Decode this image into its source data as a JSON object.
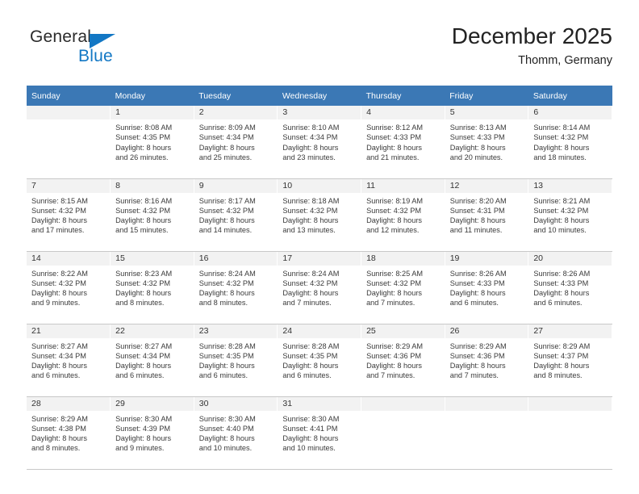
{
  "brand": {
    "name_part1": "General",
    "name_part2": "Blue",
    "accent_color": "#1277c4"
  },
  "header": {
    "title": "December 2025",
    "subtitle": "Thomm, Germany"
  },
  "theme": {
    "header_row_color": "#3b78b5",
    "daynum_band_color": "#f2f2f2",
    "grid_line_color": "#c8c8c8"
  },
  "weekdays": [
    "Sunday",
    "Monday",
    "Tuesday",
    "Wednesday",
    "Thursday",
    "Friday",
    "Saturday"
  ],
  "weeks": [
    [
      {
        "day": "",
        "empty": true,
        "sunrise": "",
        "sunset": "",
        "daylight_line1": "",
        "daylight_line2": ""
      },
      {
        "day": "1",
        "empty": false,
        "sunrise": "Sunrise: 8:08 AM",
        "sunset": "Sunset: 4:35 PM",
        "daylight_line1": "Daylight: 8 hours",
        "daylight_line2": "and 26 minutes."
      },
      {
        "day": "2",
        "empty": false,
        "sunrise": "Sunrise: 8:09 AM",
        "sunset": "Sunset: 4:34 PM",
        "daylight_line1": "Daylight: 8 hours",
        "daylight_line2": "and 25 minutes."
      },
      {
        "day": "3",
        "empty": false,
        "sunrise": "Sunrise: 8:10 AM",
        "sunset": "Sunset: 4:34 PM",
        "daylight_line1": "Daylight: 8 hours",
        "daylight_line2": "and 23 minutes."
      },
      {
        "day": "4",
        "empty": false,
        "sunrise": "Sunrise: 8:12 AM",
        "sunset": "Sunset: 4:33 PM",
        "daylight_line1": "Daylight: 8 hours",
        "daylight_line2": "and 21 minutes."
      },
      {
        "day": "5",
        "empty": false,
        "sunrise": "Sunrise: 8:13 AM",
        "sunset": "Sunset: 4:33 PM",
        "daylight_line1": "Daylight: 8 hours",
        "daylight_line2": "and 20 minutes."
      },
      {
        "day": "6",
        "empty": false,
        "sunrise": "Sunrise: 8:14 AM",
        "sunset": "Sunset: 4:32 PM",
        "daylight_line1": "Daylight: 8 hours",
        "daylight_line2": "and 18 minutes."
      }
    ],
    [
      {
        "day": "7",
        "empty": false,
        "sunrise": "Sunrise: 8:15 AM",
        "sunset": "Sunset: 4:32 PM",
        "daylight_line1": "Daylight: 8 hours",
        "daylight_line2": "and 17 minutes."
      },
      {
        "day": "8",
        "empty": false,
        "sunrise": "Sunrise: 8:16 AM",
        "sunset": "Sunset: 4:32 PM",
        "daylight_line1": "Daylight: 8 hours",
        "daylight_line2": "and 15 minutes."
      },
      {
        "day": "9",
        "empty": false,
        "sunrise": "Sunrise: 8:17 AM",
        "sunset": "Sunset: 4:32 PM",
        "daylight_line1": "Daylight: 8 hours",
        "daylight_line2": "and 14 minutes."
      },
      {
        "day": "10",
        "empty": false,
        "sunrise": "Sunrise: 8:18 AM",
        "sunset": "Sunset: 4:32 PM",
        "daylight_line1": "Daylight: 8 hours",
        "daylight_line2": "and 13 minutes."
      },
      {
        "day": "11",
        "empty": false,
        "sunrise": "Sunrise: 8:19 AM",
        "sunset": "Sunset: 4:32 PM",
        "daylight_line1": "Daylight: 8 hours",
        "daylight_line2": "and 12 minutes."
      },
      {
        "day": "12",
        "empty": false,
        "sunrise": "Sunrise: 8:20 AM",
        "sunset": "Sunset: 4:31 PM",
        "daylight_line1": "Daylight: 8 hours",
        "daylight_line2": "and 11 minutes."
      },
      {
        "day": "13",
        "empty": false,
        "sunrise": "Sunrise: 8:21 AM",
        "sunset": "Sunset: 4:32 PM",
        "daylight_line1": "Daylight: 8 hours",
        "daylight_line2": "and 10 minutes."
      }
    ],
    [
      {
        "day": "14",
        "empty": false,
        "sunrise": "Sunrise: 8:22 AM",
        "sunset": "Sunset: 4:32 PM",
        "daylight_line1": "Daylight: 8 hours",
        "daylight_line2": "and 9 minutes."
      },
      {
        "day": "15",
        "empty": false,
        "sunrise": "Sunrise: 8:23 AM",
        "sunset": "Sunset: 4:32 PM",
        "daylight_line1": "Daylight: 8 hours",
        "daylight_line2": "and 8 minutes."
      },
      {
        "day": "16",
        "empty": false,
        "sunrise": "Sunrise: 8:24 AM",
        "sunset": "Sunset: 4:32 PM",
        "daylight_line1": "Daylight: 8 hours",
        "daylight_line2": "and 8 minutes."
      },
      {
        "day": "17",
        "empty": false,
        "sunrise": "Sunrise: 8:24 AM",
        "sunset": "Sunset: 4:32 PM",
        "daylight_line1": "Daylight: 8 hours",
        "daylight_line2": "and 7 minutes."
      },
      {
        "day": "18",
        "empty": false,
        "sunrise": "Sunrise: 8:25 AM",
        "sunset": "Sunset: 4:32 PM",
        "daylight_line1": "Daylight: 8 hours",
        "daylight_line2": "and 7 minutes."
      },
      {
        "day": "19",
        "empty": false,
        "sunrise": "Sunrise: 8:26 AM",
        "sunset": "Sunset: 4:33 PM",
        "daylight_line1": "Daylight: 8 hours",
        "daylight_line2": "and 6 minutes."
      },
      {
        "day": "20",
        "empty": false,
        "sunrise": "Sunrise: 8:26 AM",
        "sunset": "Sunset: 4:33 PM",
        "daylight_line1": "Daylight: 8 hours",
        "daylight_line2": "and 6 minutes."
      }
    ],
    [
      {
        "day": "21",
        "empty": false,
        "sunrise": "Sunrise: 8:27 AM",
        "sunset": "Sunset: 4:34 PM",
        "daylight_line1": "Daylight: 8 hours",
        "daylight_line2": "and 6 minutes."
      },
      {
        "day": "22",
        "empty": false,
        "sunrise": "Sunrise: 8:27 AM",
        "sunset": "Sunset: 4:34 PM",
        "daylight_line1": "Daylight: 8 hours",
        "daylight_line2": "and 6 minutes."
      },
      {
        "day": "23",
        "empty": false,
        "sunrise": "Sunrise: 8:28 AM",
        "sunset": "Sunset: 4:35 PM",
        "daylight_line1": "Daylight: 8 hours",
        "daylight_line2": "and 6 minutes."
      },
      {
        "day": "24",
        "empty": false,
        "sunrise": "Sunrise: 8:28 AM",
        "sunset": "Sunset: 4:35 PM",
        "daylight_line1": "Daylight: 8 hours",
        "daylight_line2": "and 6 minutes."
      },
      {
        "day": "25",
        "empty": false,
        "sunrise": "Sunrise: 8:29 AM",
        "sunset": "Sunset: 4:36 PM",
        "daylight_line1": "Daylight: 8 hours",
        "daylight_line2": "and 7 minutes."
      },
      {
        "day": "26",
        "empty": false,
        "sunrise": "Sunrise: 8:29 AM",
        "sunset": "Sunset: 4:36 PM",
        "daylight_line1": "Daylight: 8 hours",
        "daylight_line2": "and 7 minutes."
      },
      {
        "day": "27",
        "empty": false,
        "sunrise": "Sunrise: 8:29 AM",
        "sunset": "Sunset: 4:37 PM",
        "daylight_line1": "Daylight: 8 hours",
        "daylight_line2": "and 8 minutes."
      }
    ],
    [
      {
        "day": "28",
        "empty": false,
        "sunrise": "Sunrise: 8:29 AM",
        "sunset": "Sunset: 4:38 PM",
        "daylight_line1": "Daylight: 8 hours",
        "daylight_line2": "and 8 minutes."
      },
      {
        "day": "29",
        "empty": false,
        "sunrise": "Sunrise: 8:30 AM",
        "sunset": "Sunset: 4:39 PM",
        "daylight_line1": "Daylight: 8 hours",
        "daylight_line2": "and 9 minutes."
      },
      {
        "day": "30",
        "empty": false,
        "sunrise": "Sunrise: 8:30 AM",
        "sunset": "Sunset: 4:40 PM",
        "daylight_line1": "Daylight: 8 hours",
        "daylight_line2": "and 10 minutes."
      },
      {
        "day": "31",
        "empty": false,
        "sunrise": "Sunrise: 8:30 AM",
        "sunset": "Sunset: 4:41 PM",
        "daylight_line1": "Daylight: 8 hours",
        "daylight_line2": "and 10 minutes."
      },
      {
        "day": "",
        "empty": true,
        "sunrise": "",
        "sunset": "",
        "daylight_line1": "",
        "daylight_line2": ""
      },
      {
        "day": "",
        "empty": true,
        "sunrise": "",
        "sunset": "",
        "daylight_line1": "",
        "daylight_line2": ""
      },
      {
        "day": "",
        "empty": true,
        "sunrise": "",
        "sunset": "",
        "daylight_line1": "",
        "daylight_line2": ""
      }
    ]
  ]
}
